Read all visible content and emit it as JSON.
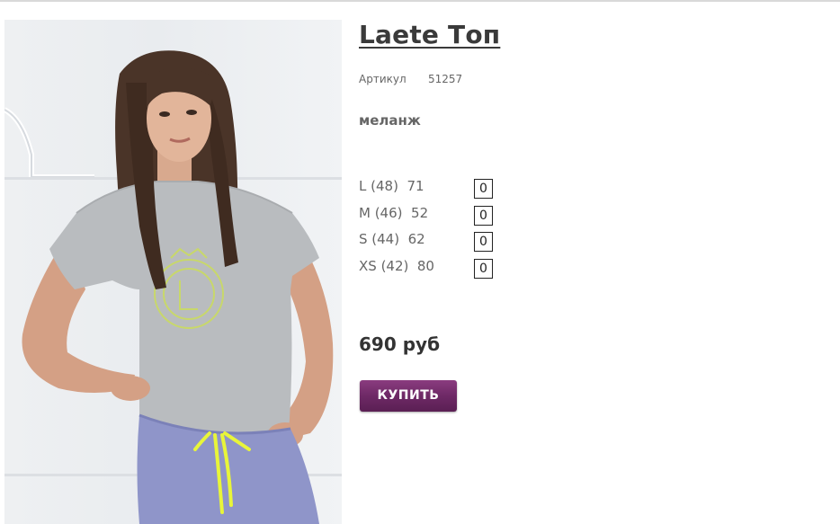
{
  "product": {
    "title": "Laete Топ",
    "sku_label": "Артикул",
    "sku_value": "51257",
    "color": "меланж",
    "price": "690 руб",
    "buy_label": "КУПИТЬ"
  },
  "sizes": [
    {
      "label": "L (48)  71",
      "qty": "0"
    },
    {
      "label": "M (46)  52",
      "qty": "0"
    },
    {
      "label": "S (44)  62",
      "qty": "0"
    },
    {
      "label": "XS (42)  80",
      "qty": "0"
    }
  ],
  "colors": {
    "buy_button": "#6e2966",
    "title": "#3a3a3a",
    "text": "#666666"
  }
}
